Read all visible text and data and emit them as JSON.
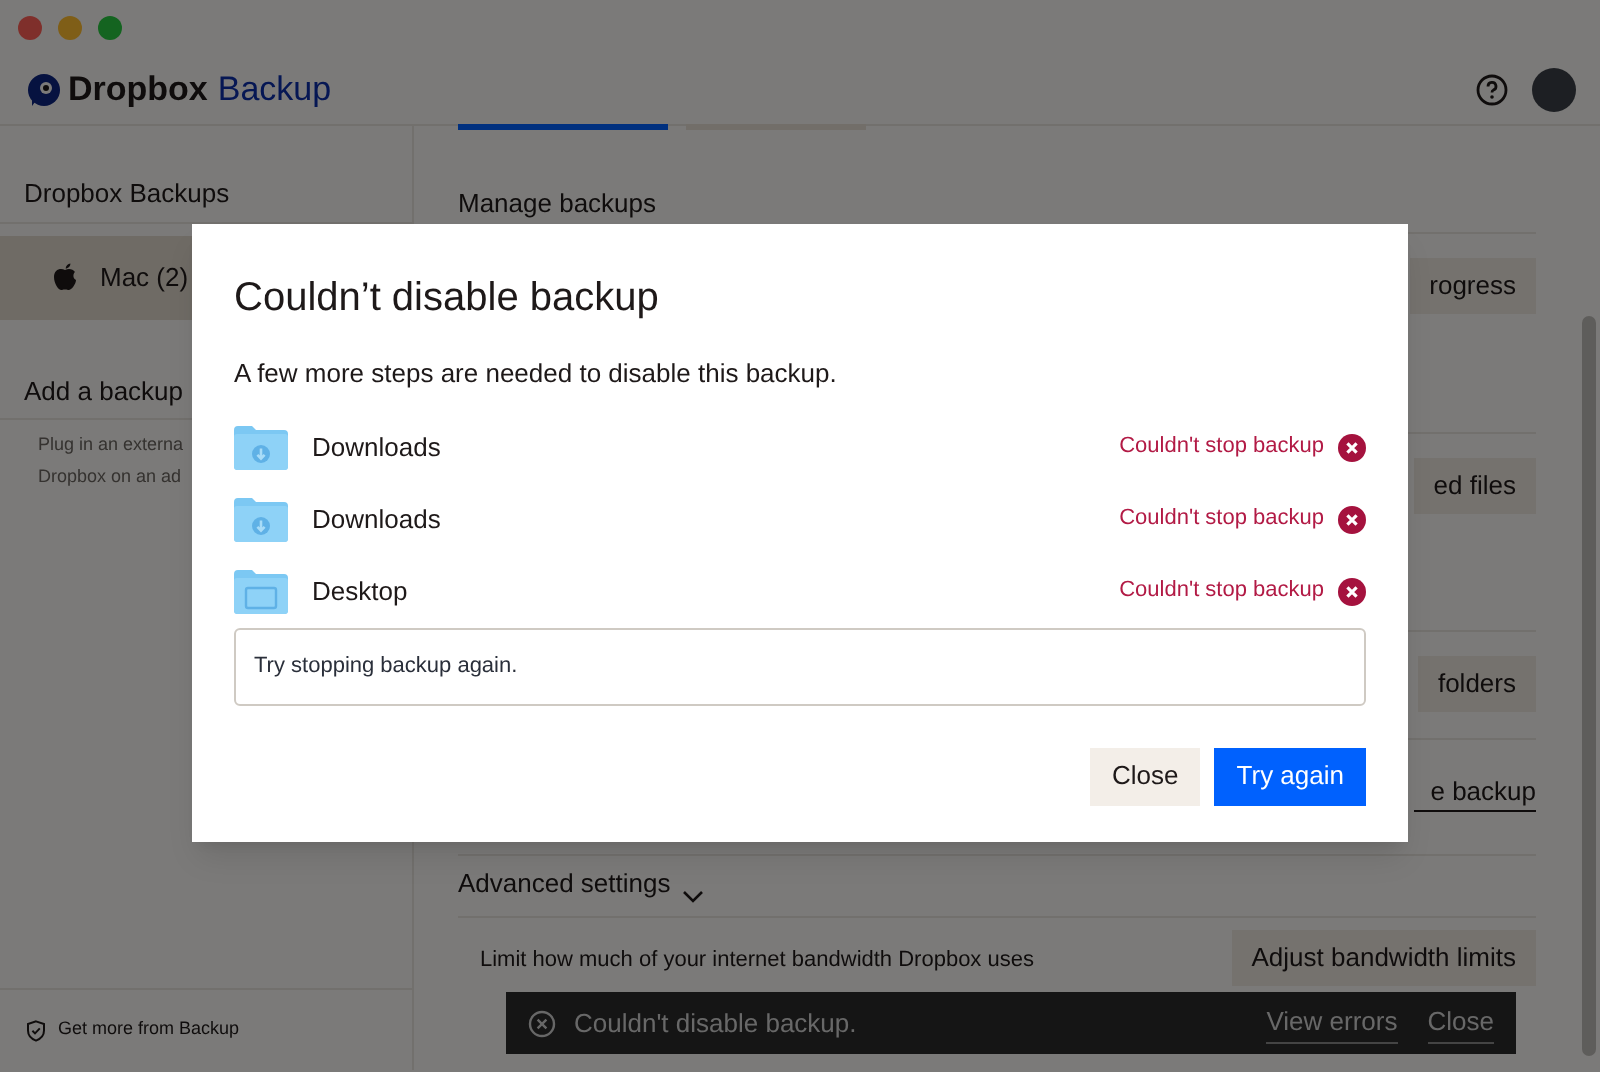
{
  "header": {
    "brand": "Dropbox",
    "product": "Backup"
  },
  "sidebar": {
    "heading": "Dropbox Backups",
    "items": [
      {
        "label": "Mac (2)",
        "selected": true
      }
    ],
    "add_heading": "Add a backup",
    "add_lines": [
      "Plug in an externa",
      "Dropbox on an ad"
    ],
    "footer": "Get more from Backup"
  },
  "main": {
    "tabs": [
      {
        "selected": true
      },
      {
        "selected": false
      }
    ],
    "title": "Manage backups",
    "actions": [
      {
        "kind": "button",
        "label": "rogress"
      },
      {
        "kind": "button",
        "label": "ed files"
      },
      {
        "kind": "button",
        "label": "folders"
      },
      {
        "kind": "link",
        "label": "e backup"
      }
    ],
    "advanced": "Advanced settings",
    "bandwidth_text": "Limit how much of your internet bandwidth Dropbox uses",
    "bandwidth_button": "Adjust bandwidth limits"
  },
  "dialog": {
    "title": "Couldn’t disable backup",
    "message": "A few more steps are needed to disable this backup.",
    "items": [
      {
        "name": "Downloads",
        "kind": "downloads",
        "status": "Couldn't stop backup"
      },
      {
        "name": "Downloads",
        "kind": "downloads",
        "status": "Couldn't stop backup"
      },
      {
        "name": "Desktop",
        "kind": "desktop",
        "status": "Couldn't stop backup"
      }
    ],
    "note": "Try stopping backup again.",
    "buttons": [
      {
        "label": "Close",
        "kind": "secondary"
      },
      {
        "label": "Try again",
        "kind": "primary"
      }
    ]
  },
  "toast": {
    "message": "Couldn't disable backup.",
    "actions": [
      "View errors",
      "Close"
    ]
  }
}
